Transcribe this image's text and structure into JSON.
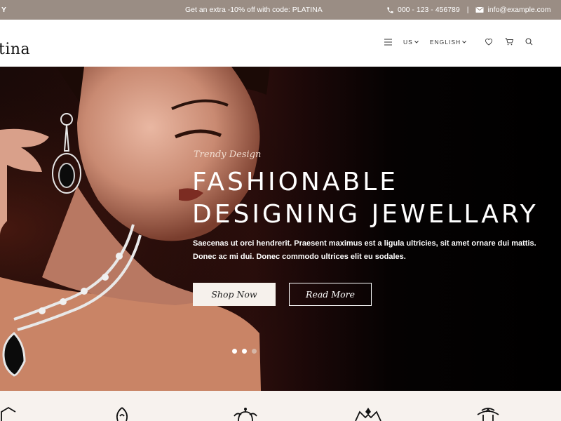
{
  "topbar": {
    "left_snip": "Y",
    "promo": "Get an extra -10% off with code: PLATINA",
    "phone": "000 - 123 - 456789",
    "separator": "|",
    "email": "info@example.com",
    "icons": [
      "phone-icon",
      "mail-icon"
    ]
  },
  "header": {
    "logo": "tina",
    "currency": "US",
    "language": "ENGLISH",
    "icons": [
      "menu-icon",
      "heart-icon",
      "cart-icon",
      "search-icon"
    ]
  },
  "hero": {
    "eyebrow": "Trendy Design",
    "title_line1": "FASHIONABLE",
    "title_line2": "DESIGNING JEWELLARY",
    "description": "Saecenas ut orci hendrerit. Praesent maximus est a ligula ultricies, sit amet ornare dui mattis. Donec ac mi dui. Donec commodo ultrices elit eu sodales.",
    "primary_button": "Shop Now",
    "secondary_button": "Read More",
    "slider_dots": 3,
    "active_dot": 1
  },
  "colors": {
    "topbar": "#9a8d84",
    "hero_bg": "#000000",
    "strip_bg": "#f7f2ee",
    "button_light": "#f6f1ec"
  },
  "categories": {
    "icons": [
      "ring-icon",
      "pendant-icon",
      "necklace-icon",
      "crown-icon",
      "bracelet-icon"
    ]
  }
}
